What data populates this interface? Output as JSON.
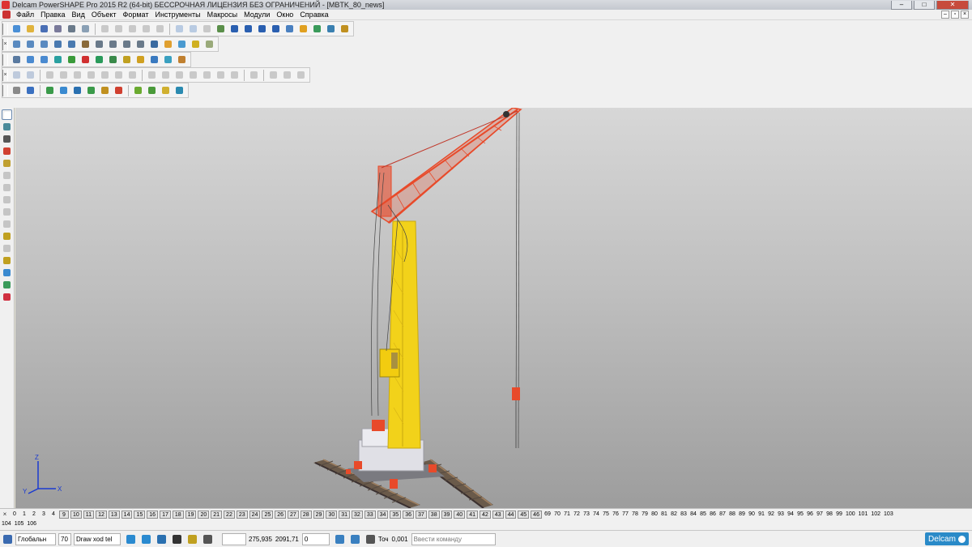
{
  "window": {
    "title": "Delcam PowerSHAPE Pro 2015 R2 (64-bit) БЕССРОЧНАЯ ЛИЦЕНЗИЯ БЕЗ ОГРАНИЧЕНИЙ - [MBTK_80_news]",
    "minimize": "–",
    "maximize": "□",
    "close": "✕"
  },
  "menubar": {
    "items": [
      "Файл",
      "Правка",
      "Вид",
      "Объект",
      "Формат",
      "Инструменты",
      "Макросы",
      "Модули",
      "Окно",
      "Справка"
    ],
    "doc_minimize": "–",
    "doc_restore": "▫",
    "doc_close": "×"
  },
  "levels": {
    "row1": [
      "0",
      "1",
      "2",
      "3",
      "4",
      "9",
      "10",
      "11",
      "12",
      "13",
      "14",
      "15",
      "16",
      "17",
      "18",
      "19",
      "20",
      "21",
      "22",
      "23",
      "24",
      "25",
      "26",
      "27",
      "28",
      "29",
      "30",
      "31",
      "32",
      "33",
      "34",
      "35",
      "36",
      "37",
      "38",
      "39",
      "40",
      "41",
      "42",
      "43",
      "44",
      "45",
      "46",
      "69",
      "70",
      "71",
      "72",
      "73",
      "74",
      "75",
      "76",
      "77",
      "78",
      "79",
      "80",
      "81",
      "82",
      "83",
      "84",
      "85",
      "86",
      "87",
      "88",
      "89",
      "90",
      "91",
      "92",
      "93",
      "94",
      "95",
      "96",
      "97",
      "98",
      "99",
      "100",
      "101",
      "102",
      "103"
    ],
    "row2": [
      "104",
      "105",
      "106"
    ],
    "close": "×"
  },
  "statusbar": {
    "workplane": "Глобальн",
    "level_number": "70",
    "level_name": "Draw xod tel",
    "coord_x": "275,935",
    "coord_y": "2091,71",
    "coord_z": "0",
    "tolerance_label": "Точ",
    "tolerance_value": "0,001",
    "command_placeholder": "Ввести команду",
    "brand": "Delcam"
  },
  "axis": {
    "x": "X",
    "y": "Y",
    "z": "Z"
  }
}
